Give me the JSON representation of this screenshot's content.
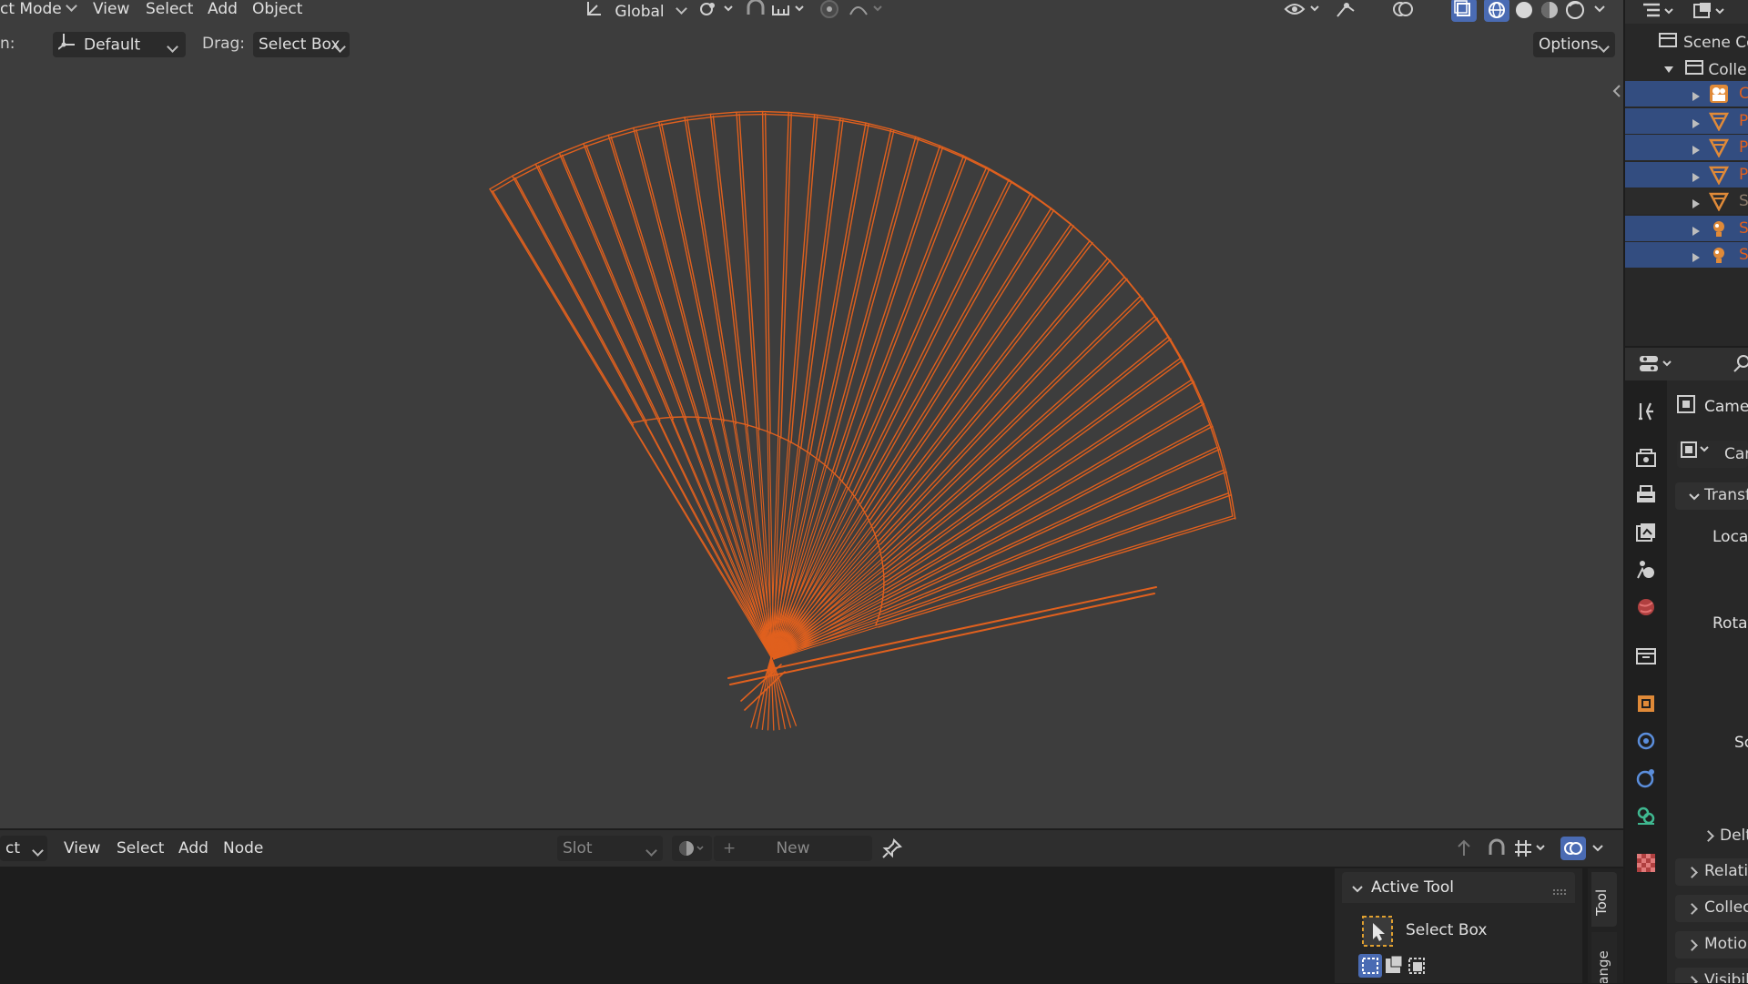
{
  "viewport_header": {
    "mode_label": "ct Mode",
    "menus": [
      "View",
      "Select",
      "Add",
      "Object"
    ],
    "orientation": "Global",
    "overlay_icons": [
      "transform-pivot-icon",
      "snap-icon",
      "snap-increment-icon",
      "proportional-edit-icon",
      "falloff-icon"
    ],
    "shading_icons": [
      "xray-icon",
      "wireframe-shading-icon",
      "solid-shading-icon",
      "material-shading-icon",
      "rendered-shading-icon"
    ]
  },
  "tool_settings": {
    "orientation_label": "n:",
    "orientation_value": "Default",
    "drag_label": "Drag:",
    "drag_value": "Select Box",
    "options_label": "Options"
  },
  "outliner": {
    "scene_label": "Scene Co",
    "collection_label": "Colle",
    "items": [
      {
        "icon": "camera-object-icon",
        "label": "C",
        "selected": true
      },
      {
        "icon": "mesh-object-icon",
        "label": "P",
        "selected": true
      },
      {
        "icon": "mesh-object-icon",
        "label": "P",
        "selected": true
      },
      {
        "icon": "mesh-object-icon",
        "label": "P",
        "selected": true
      },
      {
        "icon": "mesh-object-icon",
        "label": "S",
        "selected": false
      },
      {
        "icon": "light-object-icon",
        "label": "S",
        "selected": true
      },
      {
        "icon": "light-object-icon",
        "label": "S",
        "selected": true
      }
    ]
  },
  "properties": {
    "object_name": "Came",
    "data_name": "Car",
    "transform_label": "Transfo",
    "location_label": "Locat",
    "rotation_label": "Rotat",
    "scale_label": "Sc",
    "delta_label": "Delt",
    "sections": [
      "Relatio",
      "Collect",
      "Motion",
      "Visibili"
    ],
    "tabs": [
      "tool-tab-icon",
      "render-tab-icon",
      "output-tab-icon",
      "view-layer-tab-icon",
      "scene-tab-icon",
      "world-tab-icon",
      "collection-tab-icon",
      "object-tab-icon",
      "modifiers-tab-icon",
      "physics-tab-icon",
      "constraints-tab-icon",
      "data-tab-icon",
      "texture-tab-icon"
    ]
  },
  "node_editor": {
    "mode_label": "ct",
    "menus": [
      "View",
      "Select",
      "Add",
      "Node"
    ],
    "slot_label": "Slot",
    "new_label": "New"
  },
  "sidebar_panel": {
    "header": "Active Tool",
    "tool_name": "Select Box",
    "tab_tool": "Tool",
    "tab_arrange": "Arrange"
  },
  "colors": {
    "accent_orange": "#e0601e",
    "selection_blue": "#334d80",
    "viewport_bg": "#3d3d3d",
    "panel_bg": "#1d1d1d",
    "header_bg": "#303030"
  }
}
